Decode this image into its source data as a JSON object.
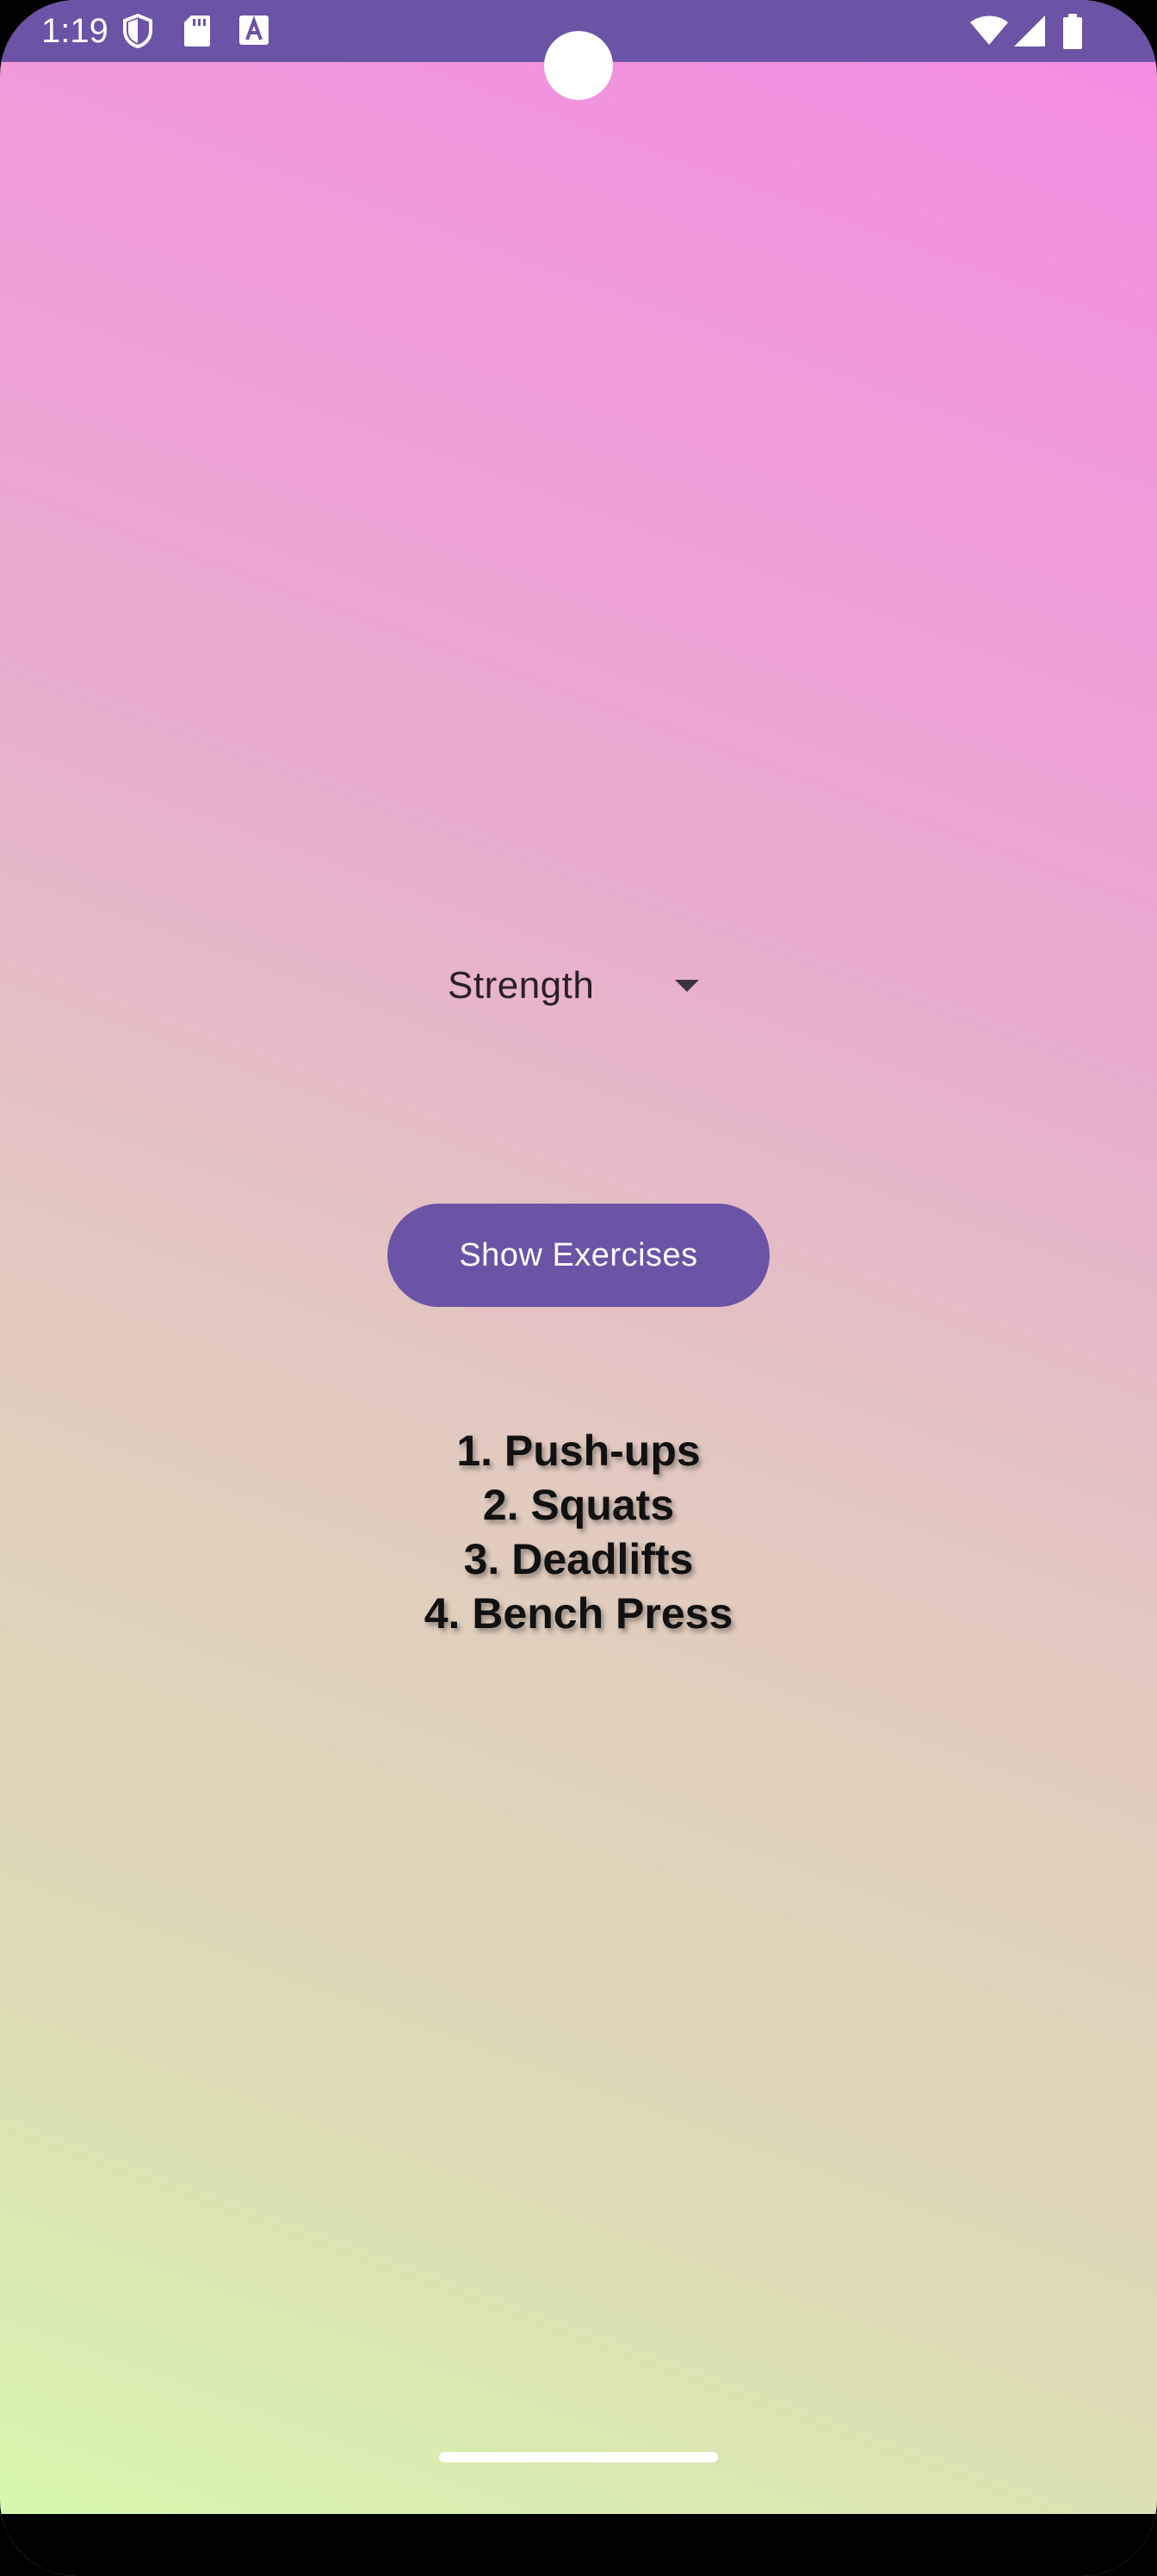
{
  "status_bar": {
    "time": "1:19",
    "left_icons": [
      "shield-icon",
      "sd-card-icon",
      "font-a-icon"
    ],
    "right_icons": [
      "wifi-icon",
      "cellular-signal-icon",
      "battery-icon"
    ],
    "background_color": "#6b53a5"
  },
  "main": {
    "category_dropdown": {
      "selected_value": "Strength"
    },
    "show_button": {
      "label": "Show Exercises",
      "color": "#6b53a5"
    },
    "exercises": [
      "1. Push-ups",
      "2. Squats",
      "3. Deadlifts",
      "4. Bench Press"
    ]
  },
  "theme": {
    "gradient_top": "#f58ae3",
    "gradient_bottom": "#d6fbab"
  }
}
